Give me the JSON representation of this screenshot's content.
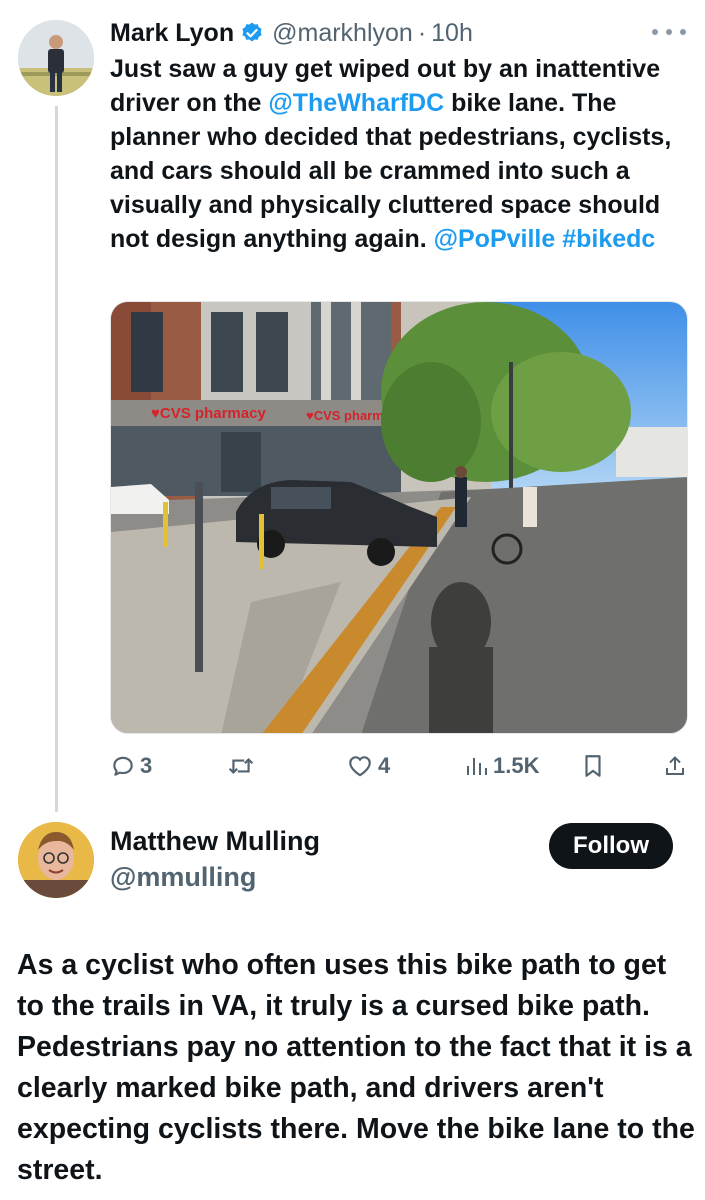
{
  "tweet": {
    "author_name": "Mark Lyon",
    "author_handle": "@markhlyon",
    "separator": "·",
    "time": "10h",
    "text_parts": {
      "t1": "Just saw a guy get wiped out by an inattentive driver on the ",
      "mention1": "@TheWharfDC",
      "t2": " bike lane. The planner who decided that pedestrians, cyclists, and cars should all be crammed into such a visually and physically cluttered space should not design anything again. ",
      "mention2": "@PoPville",
      "t3": " ",
      "hashtag": "#bikedc"
    },
    "image": {
      "sign_left": "♥CVS pharmacy",
      "sign_right": "♥CVS pharmacy"
    },
    "actions": {
      "replies": "3",
      "reposts": "",
      "likes": "4",
      "views": "1.5K"
    }
  },
  "reply": {
    "author_name": "Matthew Mulling",
    "author_handle": "@mmulling",
    "follow_label": "Follow",
    "text": "As a cyclist who often uses this bike path to get to the trails in VA, it truly is a cursed bike path. Pedestrians pay no attention to the fact that it is a clearly marked bike path, and drivers aren't expecting cyclists there. Move the bike lane to the street."
  },
  "colors": {
    "link": "#1d9bf0",
    "text": "#0f1419",
    "secondary": "#536471",
    "verified": "#1d9bf0",
    "button_bg": "#0f1419"
  }
}
